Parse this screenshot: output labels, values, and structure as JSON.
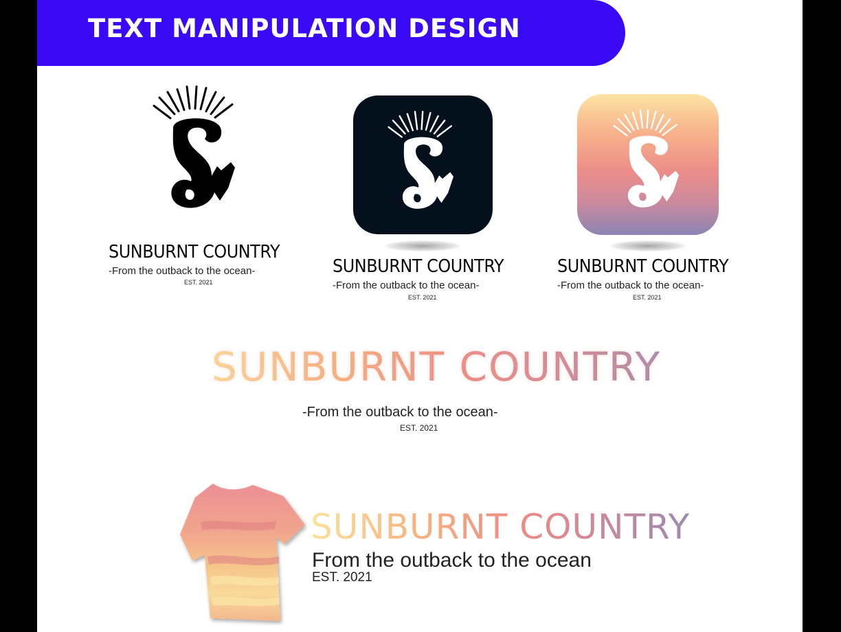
{
  "header": {
    "title": "TEXT MANIPULATION DESIGN",
    "bar_color": "#3b0af5"
  },
  "logos": [
    {
      "variant": "plain",
      "brand": "SUNBURNT COUNTRY",
      "tagline": "-From the outback to the ocean-",
      "est": "EST. 2021"
    },
    {
      "variant": "dark-tile",
      "brand": "SUNBURNT COUNTRY",
      "tagline": "-From the outback to the ocean-",
      "est": "EST. 2021"
    },
    {
      "variant": "sunset-tile",
      "brand": "SUNBURNT COUNTRY",
      "tagline": "-From the outback to the ocean-",
      "est": "EST. 2021"
    }
  ],
  "wordmark": {
    "brand": "SUNBURNT COUNTRY",
    "tagline": "-From the outback to the ocean-",
    "est": "EST. 2021"
  },
  "shirt_mockup": {
    "brand": "SUNBURNT COUNTRY",
    "tagline": "From the outback to the ocean",
    "est": "EST. 2021"
  },
  "colors": {
    "dark_tile": "#04101c",
    "sunset_top": "#fde3a4",
    "sunset_bottom": "#8b85b3"
  },
  "icons": [
    "sunburst-s-mark-icon",
    "tshirt-icon"
  ]
}
